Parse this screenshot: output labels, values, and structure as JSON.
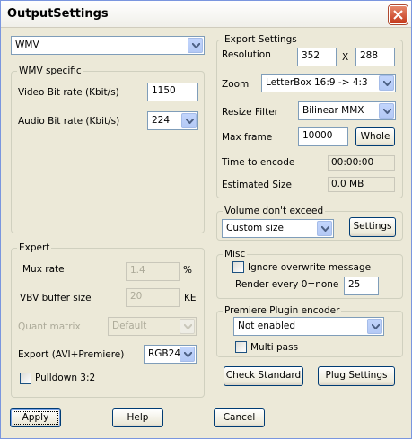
{
  "window": {
    "title": "OutputSettings"
  },
  "format_select": {
    "value": "WMV"
  },
  "wmv_specific": {
    "title": "WMV specific",
    "video_bitrate_label": "Video Bit rate (Kbit/s)",
    "video_bitrate_value": "1150",
    "audio_bitrate_label": "Audio Bit rate (Kbit/s)",
    "audio_bitrate_value": "224"
  },
  "expert": {
    "title": "Expert",
    "mux_rate_label": "Mux rate",
    "mux_rate_value": "1.4",
    "mux_rate_unit": "%",
    "vbv_label": "VBV buffer size",
    "vbv_value": "20",
    "vbv_unit": "KE",
    "quant_label": "Quant matrix",
    "quant_value": "Default",
    "export_label": "Export (AVI+Premiere)",
    "export_value": "RGB24",
    "pulldown_label": "Pulldown 3:2"
  },
  "export_settings": {
    "title": "Export Settings",
    "resolution_label": "Resolution",
    "res_width": "352",
    "res_x": "X",
    "res_height": "288",
    "zoom_label": "Zoom",
    "zoom_value": "LetterBox 16:9 -> 4:3",
    "resize_label": "Resize Filter",
    "resize_value": "Bilinear MMX",
    "maxframe_label": "Max frame",
    "maxframe_value": "10000",
    "whole_label": "Whole",
    "time_label": "Time to encode",
    "time_value": "00:00:00",
    "size_label": "Estimated Size",
    "size_value": "0.0 MB"
  },
  "volume": {
    "title": "Volume don't exceed",
    "value": "Custom size",
    "settings_label": "Settings"
  },
  "misc": {
    "title": "Misc",
    "ignore_label": "Ignore overwrite message",
    "render_label": "Render every 0=none",
    "render_value": "25"
  },
  "premiere": {
    "title": "Premiere Plugin encoder",
    "value": "Not enabled",
    "multipass_label": "Multi pass"
  },
  "buttons": {
    "check_standard": "Check Standard",
    "plug_settings": "Plug Settings",
    "apply": "Apply",
    "help": "Help",
    "cancel": "Cancel"
  }
}
